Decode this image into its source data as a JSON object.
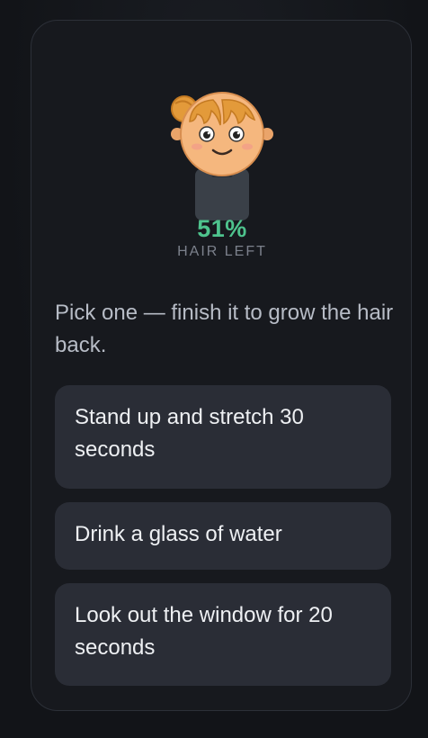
{
  "character": {
    "hair_left_percent": "51%",
    "hair_left_label": "HAIR LEFT",
    "hair_fraction": 0.51
  },
  "colors": {
    "accent_green": "#4ec38d",
    "hair": "#e39a3a",
    "skin": "#f5b77e",
    "shirt": "#3a4048"
  },
  "prompt": {
    "text": "Pick one — finish it to grow the hair back."
  },
  "tasks": [
    {
      "label": "Stand up and stretch 30 seconds"
    },
    {
      "label": "Drink a glass of water"
    },
    {
      "label": "Look out the window for 20 seconds"
    }
  ]
}
